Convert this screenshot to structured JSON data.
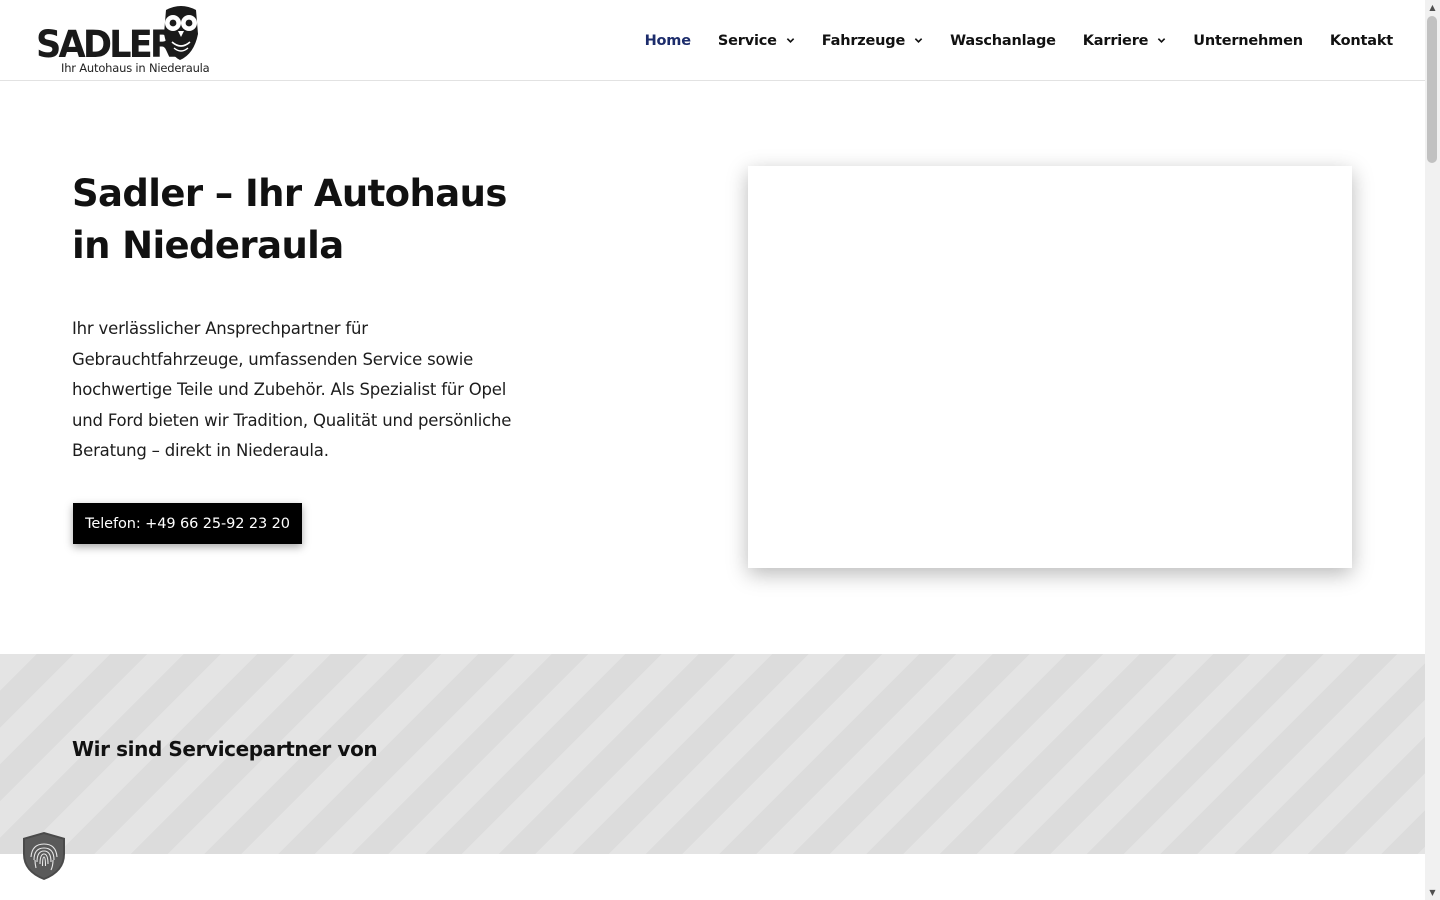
{
  "header": {
    "logo": {
      "wordmark": "SADLER",
      "tagline": "Ihr Autohaus in Niederaula",
      "icon": "owl-logo-icon"
    },
    "nav": [
      {
        "label": "Home",
        "active": true,
        "dropdown": false
      },
      {
        "label": "Service",
        "active": false,
        "dropdown": true
      },
      {
        "label": "Fahrzeuge",
        "active": false,
        "dropdown": true
      },
      {
        "label": "Waschanlage",
        "active": false,
        "dropdown": false
      },
      {
        "label": "Karriere",
        "active": false,
        "dropdown": true
      },
      {
        "label": "Unternehmen",
        "active": false,
        "dropdown": false
      },
      {
        "label": "Kontakt",
        "active": false,
        "dropdown": false
      }
    ]
  },
  "hero": {
    "title_line1": "Sadler – Ihr Autohaus",
    "title_line2": "in Niederaula",
    "text": "Ihr verlässlicher Ansprechpartner für Gebrauchtfahrzeuge, umfassenden Service sowie hochwertige Teile und Zubehör. Als Spezialist für Opel und Ford bieten wir Tradition, Qualität und persönliche Beratung – direkt in Niederaula.",
    "phone_button": "Telefon: +49 66 25-92 23 20"
  },
  "partners": {
    "title": "Wir sind Servicepartner von"
  },
  "privacy": {
    "icon": "fingerprint-shield-icon"
  },
  "colors": {
    "nav_active": "#1c2c6b",
    "button_bg": "#000000",
    "band_bg": "#e4e4e4"
  }
}
